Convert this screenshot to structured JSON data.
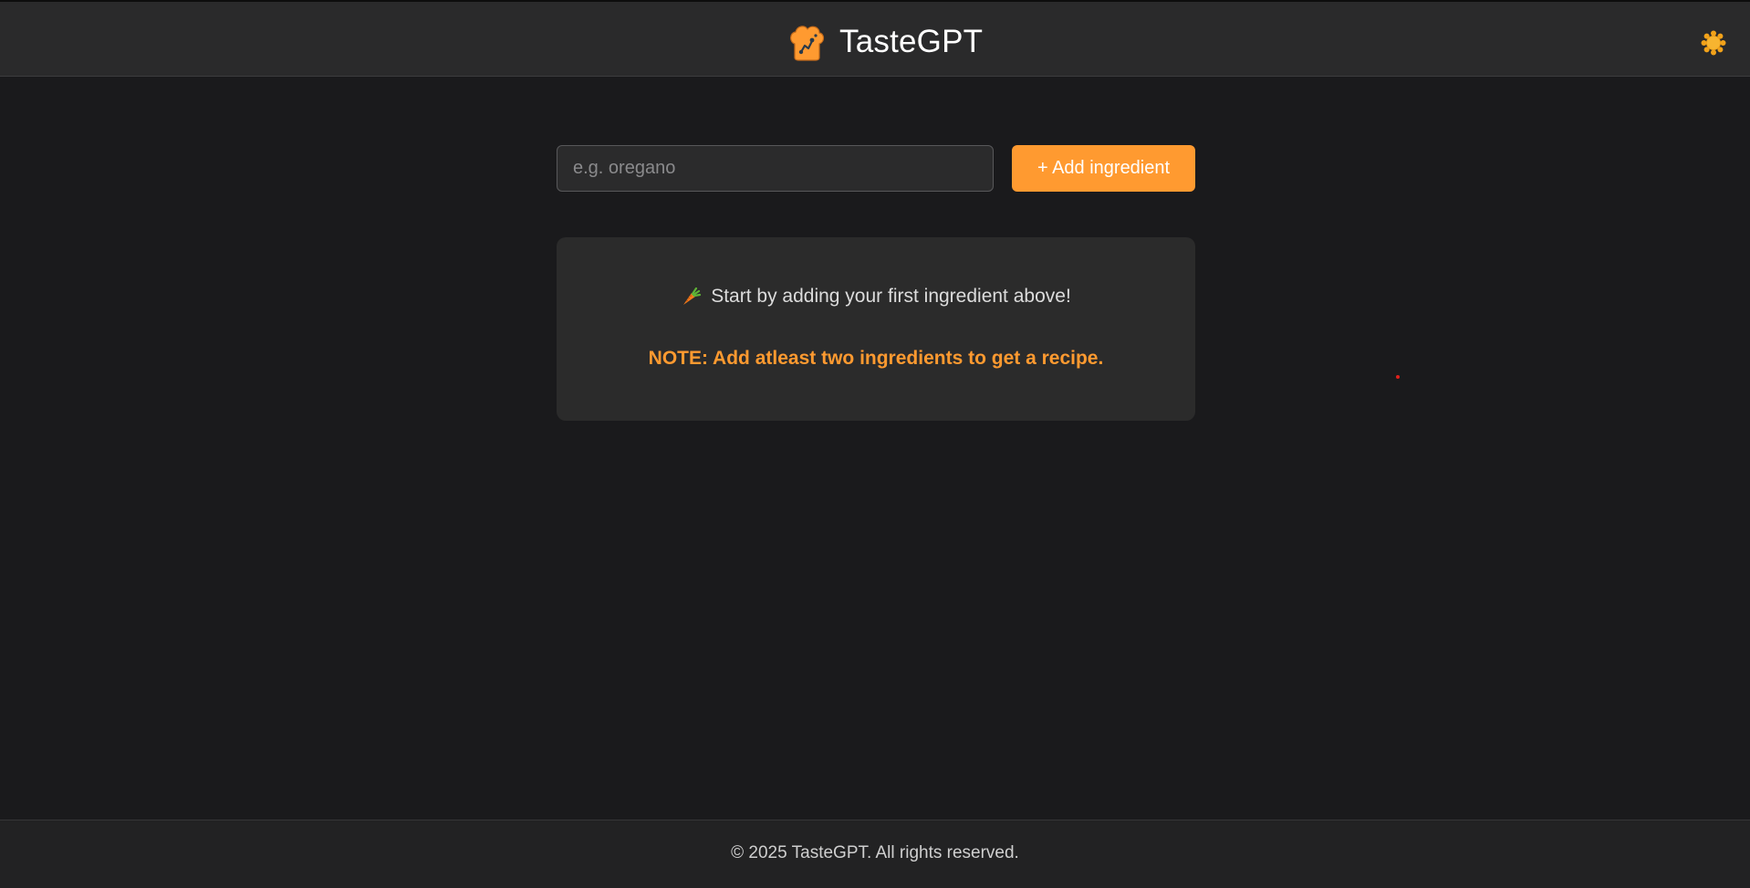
{
  "header": {
    "title": "TasteGPT",
    "logo_icon": "chef-hat-icon",
    "theme_toggle_icon": "sun-icon"
  },
  "ingredient_form": {
    "input_value": "",
    "input_placeholder": "e.g. oregano",
    "add_button_label": "+ Add ingredient"
  },
  "info_card": {
    "hint_icon": "carrot-icon",
    "hint_text": "Start by adding your first ingredient above!",
    "note_text": "NOTE: Add atleast two ingredients to get a recipe."
  },
  "footer": {
    "copyright": "© 2025 TasteGPT. All rights reserved."
  },
  "colors": {
    "background": "#1a1a1c",
    "header_bg": "#2a2a2b",
    "accent": "#ff9a30",
    "card_bg": "#2b2b2b",
    "footer_bg": "#222223"
  }
}
